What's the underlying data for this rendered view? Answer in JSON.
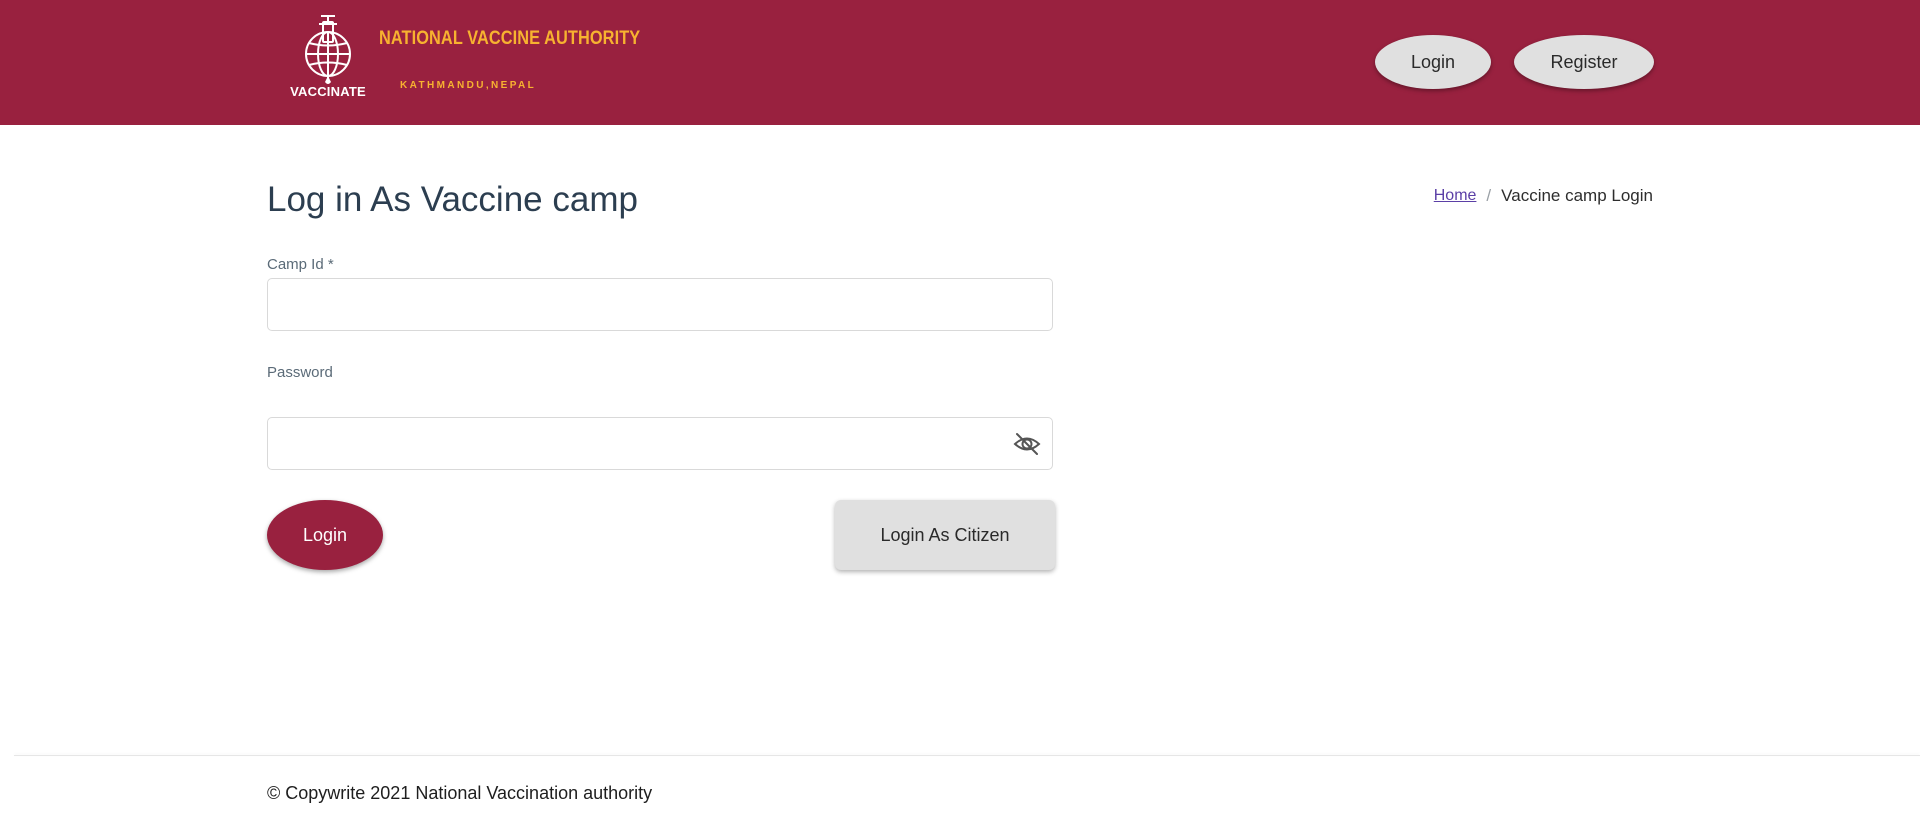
{
  "header": {
    "logo_caption": "VACCINATE",
    "brand_title": "NATIONAL VACCINE AUTHORITY",
    "brand_subtitle": "KATHMANDU,NEPAL",
    "login_label": "Login",
    "register_label": "Register",
    "background_color": "#99213f",
    "brand_color": "#f7b230"
  },
  "page": {
    "title": "Log in As Vaccine camp"
  },
  "breadcrumb": {
    "home": "Home",
    "separator": "/",
    "current": "Vaccine camp Login"
  },
  "form": {
    "camp_id_label": "Camp Id *",
    "camp_id_value": "",
    "password_label": "Password",
    "password_value": "",
    "password_toggle_icon": "eye-off-icon",
    "login_button": "Login",
    "citizen_button": "Login As Citizen"
  },
  "footer": {
    "text": "© Copywrite 2021 National Vaccination authority"
  }
}
